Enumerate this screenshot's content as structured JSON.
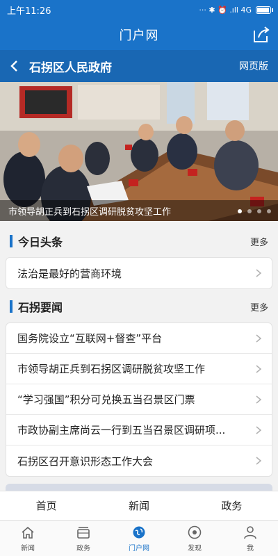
{
  "status_bar": {
    "time": "上午11:26",
    "indicators": "··· ✱ ⏰ .ıll 4G",
    "network": "4G",
    "battery_level": 0.85
  },
  "app_bar": {
    "title": "门户网"
  },
  "sub_bar": {
    "title": "石拐区人民政府",
    "web_link": "网页版"
  },
  "banner": {
    "caption": "市领导胡正兵到石拐区调研脱贫攻坚工作",
    "slides": 4,
    "active_slide": 0
  },
  "sections": {
    "headlines": {
      "title": "今日头条",
      "more": "更多",
      "items": [
        "法治是最好的营商环境"
      ]
    },
    "news": {
      "title": "石拐要闻",
      "more": "更多",
      "items": [
        "国务院设立“互联网+督查”平台",
        "市领导胡正兵到石拐区调研脱贫攻坚工作",
        "“学习强国”积分可兑换五当召景区门票",
        "市政协副主席尚云一行到五当召景区调研项...",
        "石拐区召开意识形态工作大会"
      ]
    }
  },
  "tabs": [
    "首页",
    "新闻",
    "政务"
  ],
  "nav": [
    {
      "label": "新闻",
      "icon": "home-icon"
    },
    {
      "label": "政务",
      "icon": "briefcase-icon"
    },
    {
      "label": "门户网",
      "icon": "globe-icon",
      "active": true
    },
    {
      "label": "发现",
      "icon": "compass-icon"
    },
    {
      "label": "我",
      "icon": "person-icon"
    }
  ],
  "colors": {
    "primary": "#1a73c9",
    "sub_bar": "#1967b3"
  }
}
